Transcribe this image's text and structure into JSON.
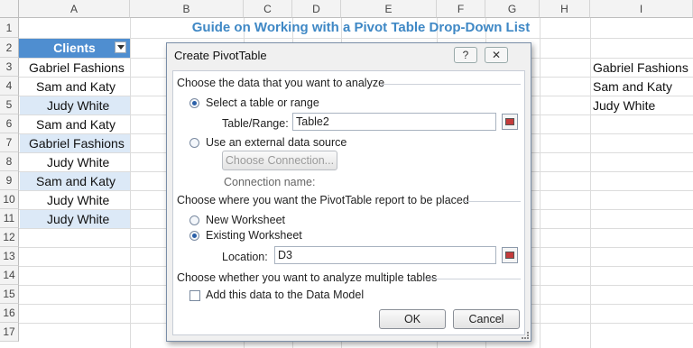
{
  "columns": [
    "A",
    "B",
    "C",
    "D",
    "E",
    "F",
    "G",
    "H",
    "I"
  ],
  "rows": [
    "1",
    "2",
    "3",
    "4",
    "5",
    "6",
    "7",
    "8",
    "9",
    "10",
    "11",
    "12",
    "13",
    "14",
    "15",
    "16",
    "17"
  ],
  "title": "Guide on Working with a Pivot Table Drop-Down List",
  "header_cell": "Clients",
  "col_a": [
    "Gabriel Fashions",
    "Sam and Katy",
    "Judy White",
    "Sam and Katy",
    "Gabriel Fashions",
    "Judy White",
    "Sam and Katy",
    "Judy White",
    "Judy White"
  ],
  "col_i": [
    "Gabriel Fashions",
    "Sam and Katy",
    "Judy White"
  ],
  "dialog": {
    "title": "Create PivotTable",
    "help": "?",
    "close": "✕",
    "section1": "Choose the data that you want to analyze",
    "opt_table": "Select a table or range",
    "table_range_label": "Table/Range:",
    "table_range_value": "Table2",
    "opt_external": "Use an external data source",
    "choose_connection": "Choose Connection...",
    "connection_name": "Connection name:",
    "section2": "Choose where you want the PivotTable report to be placed",
    "opt_new": "New Worksheet",
    "opt_existing": "Existing Worksheet",
    "location_label": "Location:",
    "location_value": "D3",
    "section3": "Choose whether you want to analyze multiple tables",
    "data_model": "Add this data to the Data Model",
    "ok": "OK",
    "cancel": "Cancel"
  }
}
